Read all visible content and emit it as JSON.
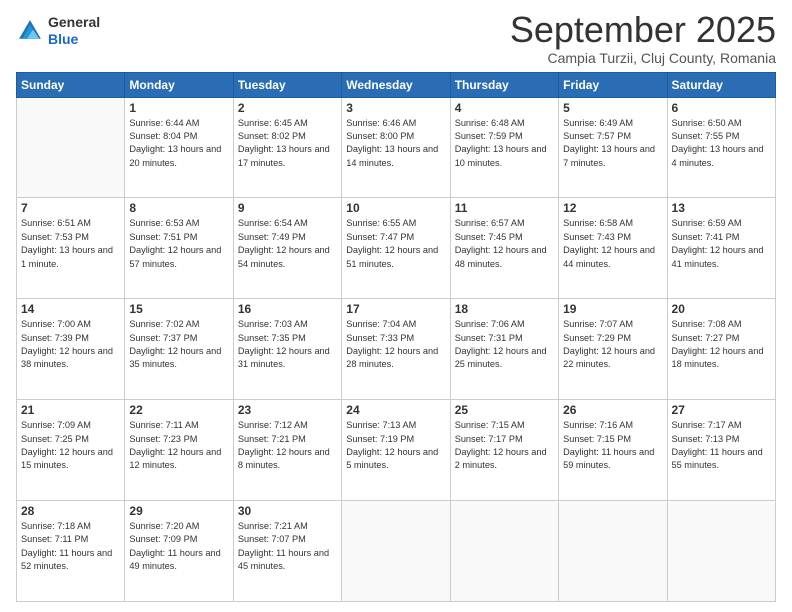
{
  "header": {
    "logo": {
      "general": "General",
      "blue": "Blue"
    },
    "title": "September 2025",
    "location": "Campia Turzii, Cluj County, Romania"
  },
  "days_of_week": [
    "Sunday",
    "Monday",
    "Tuesday",
    "Wednesday",
    "Thursday",
    "Friday",
    "Saturday"
  ],
  "weeks": [
    [
      {
        "day": "",
        "sunrise": "",
        "sunset": "",
        "daylight": "",
        "empty": true
      },
      {
        "day": "1",
        "sunrise": "Sunrise: 6:44 AM",
        "sunset": "Sunset: 8:04 PM",
        "daylight": "Daylight: 13 hours and 20 minutes."
      },
      {
        "day": "2",
        "sunrise": "Sunrise: 6:45 AM",
        "sunset": "Sunset: 8:02 PM",
        "daylight": "Daylight: 13 hours and 17 minutes."
      },
      {
        "day": "3",
        "sunrise": "Sunrise: 6:46 AM",
        "sunset": "Sunset: 8:00 PM",
        "daylight": "Daylight: 13 hours and 14 minutes."
      },
      {
        "day": "4",
        "sunrise": "Sunrise: 6:48 AM",
        "sunset": "Sunset: 7:59 PM",
        "daylight": "Daylight: 13 hours and 10 minutes."
      },
      {
        "day": "5",
        "sunrise": "Sunrise: 6:49 AM",
        "sunset": "Sunset: 7:57 PM",
        "daylight": "Daylight: 13 hours and 7 minutes."
      },
      {
        "day": "6",
        "sunrise": "Sunrise: 6:50 AM",
        "sunset": "Sunset: 7:55 PM",
        "daylight": "Daylight: 13 hours and 4 minutes."
      }
    ],
    [
      {
        "day": "7",
        "sunrise": "Sunrise: 6:51 AM",
        "sunset": "Sunset: 7:53 PM",
        "daylight": "Daylight: 13 hours and 1 minute."
      },
      {
        "day": "8",
        "sunrise": "Sunrise: 6:53 AM",
        "sunset": "Sunset: 7:51 PM",
        "daylight": "Daylight: 12 hours and 57 minutes."
      },
      {
        "day": "9",
        "sunrise": "Sunrise: 6:54 AM",
        "sunset": "Sunset: 7:49 PM",
        "daylight": "Daylight: 12 hours and 54 minutes."
      },
      {
        "day": "10",
        "sunrise": "Sunrise: 6:55 AM",
        "sunset": "Sunset: 7:47 PM",
        "daylight": "Daylight: 12 hours and 51 minutes."
      },
      {
        "day": "11",
        "sunrise": "Sunrise: 6:57 AM",
        "sunset": "Sunset: 7:45 PM",
        "daylight": "Daylight: 12 hours and 48 minutes."
      },
      {
        "day": "12",
        "sunrise": "Sunrise: 6:58 AM",
        "sunset": "Sunset: 7:43 PM",
        "daylight": "Daylight: 12 hours and 44 minutes."
      },
      {
        "day": "13",
        "sunrise": "Sunrise: 6:59 AM",
        "sunset": "Sunset: 7:41 PM",
        "daylight": "Daylight: 12 hours and 41 minutes."
      }
    ],
    [
      {
        "day": "14",
        "sunrise": "Sunrise: 7:00 AM",
        "sunset": "Sunset: 7:39 PM",
        "daylight": "Daylight: 12 hours and 38 minutes."
      },
      {
        "day": "15",
        "sunrise": "Sunrise: 7:02 AM",
        "sunset": "Sunset: 7:37 PM",
        "daylight": "Daylight: 12 hours and 35 minutes."
      },
      {
        "day": "16",
        "sunrise": "Sunrise: 7:03 AM",
        "sunset": "Sunset: 7:35 PM",
        "daylight": "Daylight: 12 hours and 31 minutes."
      },
      {
        "day": "17",
        "sunrise": "Sunrise: 7:04 AM",
        "sunset": "Sunset: 7:33 PM",
        "daylight": "Daylight: 12 hours and 28 minutes."
      },
      {
        "day": "18",
        "sunrise": "Sunrise: 7:06 AM",
        "sunset": "Sunset: 7:31 PM",
        "daylight": "Daylight: 12 hours and 25 minutes."
      },
      {
        "day": "19",
        "sunrise": "Sunrise: 7:07 AM",
        "sunset": "Sunset: 7:29 PM",
        "daylight": "Daylight: 12 hours and 22 minutes."
      },
      {
        "day": "20",
        "sunrise": "Sunrise: 7:08 AM",
        "sunset": "Sunset: 7:27 PM",
        "daylight": "Daylight: 12 hours and 18 minutes."
      }
    ],
    [
      {
        "day": "21",
        "sunrise": "Sunrise: 7:09 AM",
        "sunset": "Sunset: 7:25 PM",
        "daylight": "Daylight: 12 hours and 15 minutes."
      },
      {
        "day": "22",
        "sunrise": "Sunrise: 7:11 AM",
        "sunset": "Sunset: 7:23 PM",
        "daylight": "Daylight: 12 hours and 12 minutes."
      },
      {
        "day": "23",
        "sunrise": "Sunrise: 7:12 AM",
        "sunset": "Sunset: 7:21 PM",
        "daylight": "Daylight: 12 hours and 8 minutes."
      },
      {
        "day": "24",
        "sunrise": "Sunrise: 7:13 AM",
        "sunset": "Sunset: 7:19 PM",
        "daylight": "Daylight: 12 hours and 5 minutes."
      },
      {
        "day": "25",
        "sunrise": "Sunrise: 7:15 AM",
        "sunset": "Sunset: 7:17 PM",
        "daylight": "Daylight: 12 hours and 2 minutes."
      },
      {
        "day": "26",
        "sunrise": "Sunrise: 7:16 AM",
        "sunset": "Sunset: 7:15 PM",
        "daylight": "Daylight: 11 hours and 59 minutes."
      },
      {
        "day": "27",
        "sunrise": "Sunrise: 7:17 AM",
        "sunset": "Sunset: 7:13 PM",
        "daylight": "Daylight: 11 hours and 55 minutes."
      }
    ],
    [
      {
        "day": "28",
        "sunrise": "Sunrise: 7:18 AM",
        "sunset": "Sunset: 7:11 PM",
        "daylight": "Daylight: 11 hours and 52 minutes."
      },
      {
        "day": "29",
        "sunrise": "Sunrise: 7:20 AM",
        "sunset": "Sunset: 7:09 PM",
        "daylight": "Daylight: 11 hours and 49 minutes."
      },
      {
        "day": "30",
        "sunrise": "Sunrise: 7:21 AM",
        "sunset": "Sunset: 7:07 PM",
        "daylight": "Daylight: 11 hours and 45 minutes."
      },
      {
        "day": "",
        "sunrise": "",
        "sunset": "",
        "daylight": "",
        "empty": true
      },
      {
        "day": "",
        "sunrise": "",
        "sunset": "",
        "daylight": "",
        "empty": true
      },
      {
        "day": "",
        "sunrise": "",
        "sunset": "",
        "daylight": "",
        "empty": true
      },
      {
        "day": "",
        "sunrise": "",
        "sunset": "",
        "daylight": "",
        "empty": true
      }
    ]
  ]
}
